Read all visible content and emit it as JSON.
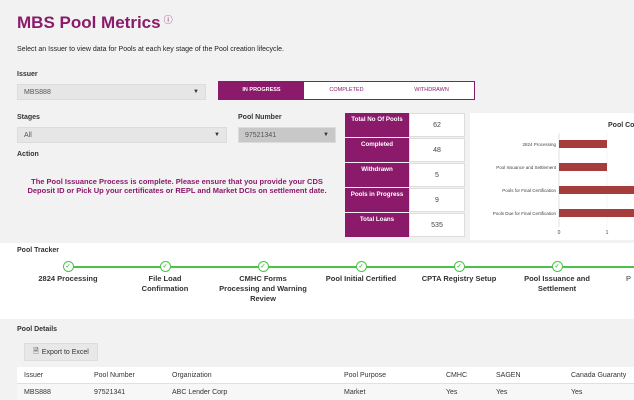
{
  "header": {
    "title": "MBS Pool Metrics",
    "info_glyph": "ⓘ",
    "subtitle": "Select an Issuer to view data for Pools at each key stage of the Pool creation lifecycle."
  },
  "issuer": {
    "label": "Issuer",
    "value": "MBS888"
  },
  "tabs": [
    {
      "label": "IN PROGRESS",
      "active": true
    },
    {
      "label": "COMPLETED",
      "active": false
    },
    {
      "label": "WITHDRAWN",
      "active": false
    }
  ],
  "stages": {
    "label": "Stages",
    "value": "All"
  },
  "pool_number": {
    "label": "Pool Number",
    "value": "97521341"
  },
  "action": {
    "label": "Action",
    "message": "The Pool Issuance Process is complete. Please ensure that you provide your CDS Deposit ID or Pick Up your certificates or REPL and Market DCIs on settlement date."
  },
  "stats": [
    {
      "label": "Total No Of Pools",
      "value": "62"
    },
    {
      "label": "Completed",
      "value": "48"
    },
    {
      "label": "Withdrawn",
      "value": "5"
    },
    {
      "label": "Pools in Progress",
      "value": "9"
    },
    {
      "label": "Total Loans",
      "value": "535"
    }
  ],
  "chart_data": {
    "type": "bar",
    "title": "Pool Co",
    "orientation": "horizontal",
    "categories": [
      "2824 Processing",
      "Pool Issuance and Settlement",
      "Pools for Final Certification",
      "Pools Due for Final Certification"
    ],
    "values": [
      1,
      1,
      2,
      2
    ],
    "xlim": [
      0,
      1.15
    ],
    "xticks": [
      "0",
      "1"
    ],
    "bar_color": "#a63d3d"
  },
  "tracker": {
    "label": "Pool Tracker",
    "steps": [
      "2824 Processing",
      "File Load Confirmation",
      "CMHC Forms Processing and Warning Review",
      "Pool Initial Certified",
      "CPTA Registry Setup",
      "Pool Issuance and Settlement",
      "P"
    ],
    "check_glyph": "✓",
    "accent": "#4cc24c"
  },
  "details": {
    "label": "Pool Details",
    "export_label": "Export to Excel",
    "export_icon": "file-icon",
    "columns": [
      "Issuer",
      "Pool Number",
      "Organization",
      "Pool Purpose",
      "CMHC",
      "SAGEN",
      "Canada Guaranty"
    ],
    "rows": [
      [
        "MBS888",
        "97521341",
        "ABC Lender Corp",
        "Market",
        "Yes",
        "Yes",
        "Yes"
      ]
    ]
  },
  "colors": {
    "brand": "#8b1a6b"
  }
}
